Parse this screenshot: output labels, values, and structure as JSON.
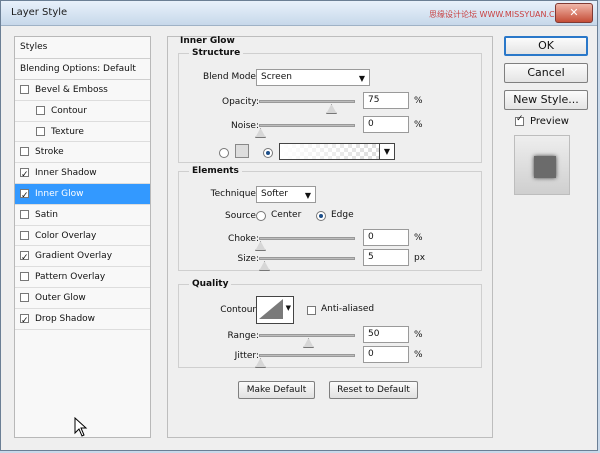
{
  "window": {
    "title": "Layer Style",
    "watermark": "思缘设计论坛 WWW.MISSYUAN.COM"
  },
  "sidebar": {
    "header": "Styles",
    "blending": "Blending Options: Default",
    "items": [
      {
        "label": "Bevel & Emboss",
        "checked": false
      },
      {
        "label": "Contour",
        "checked": false
      },
      {
        "label": "Texture",
        "checked": false
      },
      {
        "label": "Stroke",
        "checked": false
      },
      {
        "label": "Inner Shadow",
        "checked": true
      },
      {
        "label": "Inner Glow",
        "checked": true,
        "active": true
      },
      {
        "label": "Satin",
        "checked": false
      },
      {
        "label": "Color Overlay",
        "checked": false
      },
      {
        "label": "Gradient Overlay",
        "checked": true
      },
      {
        "label": "Pattern Overlay",
        "checked": false
      },
      {
        "label": "Outer Glow",
        "checked": false
      },
      {
        "label": "Drop Shadow",
        "checked": true
      }
    ]
  },
  "panel": {
    "title": "Inner Glow",
    "structure": {
      "label": "Structure",
      "blend_mode_label": "Blend Mode:",
      "blend_mode": "Screen",
      "opacity_label": "Opacity:",
      "opacity": "75",
      "opacity_unit": "%",
      "noise_label": "Noise:",
      "noise": "0",
      "noise_unit": "%"
    },
    "elements": {
      "label": "Elements",
      "technique_label": "Technique:",
      "technique": "Softer",
      "source_label": "Source:",
      "source_center": "Center",
      "source_edge": "Edge",
      "choke_label": "Choke:",
      "choke": "0",
      "choke_unit": "%",
      "size_label": "Size:",
      "size": "5",
      "size_unit": "px"
    },
    "quality": {
      "label": "Quality",
      "contour_label": "Contour:",
      "anti_aliased": "Anti-aliased",
      "range_label": "Range:",
      "range": "50",
      "range_unit": "%",
      "jitter_label": "Jitter:",
      "jitter": "0",
      "jitter_unit": "%"
    },
    "make_default": "Make Default",
    "reset_default": "Reset to Default"
  },
  "actions": {
    "ok": "OK",
    "cancel": "Cancel",
    "new_style": "New Style...",
    "preview": "Preview"
  }
}
